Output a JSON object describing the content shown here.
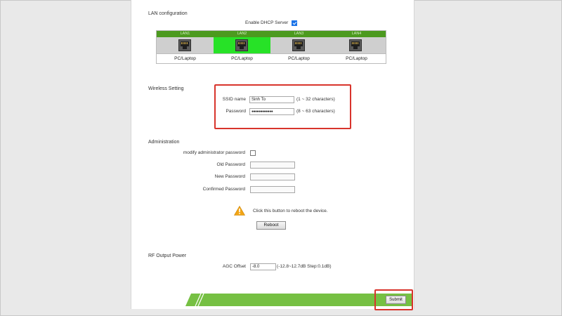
{
  "lan": {
    "title": "LAN configuration",
    "dhcp_label": "Enable DHCP Server",
    "dhcp_checked": true,
    "ports": [
      {
        "name": "LAN1",
        "device": "PC/Laptop",
        "active": false
      },
      {
        "name": "LAN2",
        "device": "PC/Laptop",
        "active": true
      },
      {
        "name": "LAN3",
        "device": "PC/Laptop",
        "active": false
      },
      {
        "name": "LAN4",
        "device": "PC/Laptop",
        "active": false
      }
    ]
  },
  "wireless": {
    "title": "Wireless Setting",
    "ssid_label": "SSID name",
    "ssid_value": "Sinh To",
    "ssid_hint": "(1 ~ 32 characters)",
    "password_label": "Password",
    "password_value": "●●●●●●●●●●●●",
    "password_hint": "(8 ~ 63 characters)"
  },
  "admin": {
    "title": "Administration",
    "modify_label": "modify administrator password",
    "modify_checked": false,
    "old_label": "Old Password",
    "new_label": "New Password",
    "confirm_label": "Confirmed Password",
    "reboot_text": "Click this button to reboot the device.",
    "reboot_button": "Reboot"
  },
  "rf": {
    "title": "RF Output Power",
    "agc_label": "AGC Offset",
    "agc_value": "-8.0",
    "agc_hint": "(-12.8~12.7dB Step:0.1dB)"
  },
  "footer": {
    "submit_button": "Submit"
  },
  "colors": {
    "lan_header": "#4c9a1f",
    "lan_active": "#27e227",
    "footer_green": "#76c043",
    "highlight": "#d8342c"
  }
}
